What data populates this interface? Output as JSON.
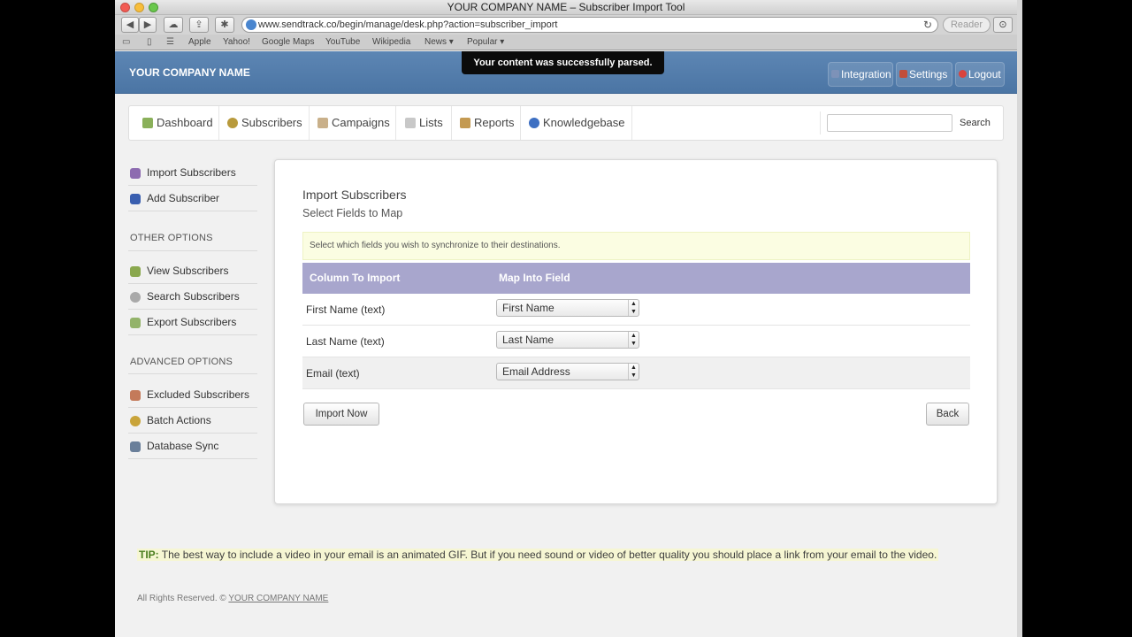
{
  "browser": {
    "window_title": "YOUR COMPANY NAME – Subscriber Import Tool",
    "url": "www.sendtrack.co/begin/manage/desk.php?action=subscriber_import",
    "reader_label": "Reader",
    "bookmarks": [
      "Apple",
      "Yahoo!",
      "Google Maps",
      "YouTube",
      "Wikipedia",
      "News ▾",
      "Popular ▾"
    ]
  },
  "header": {
    "company_name": "YOUR COMPANY NAME",
    "toast": "Your content was successfully parsed.",
    "buttons": [
      {
        "label": "Integration",
        "icon": "plug-icon"
      },
      {
        "label": "Settings",
        "icon": "tools-icon"
      },
      {
        "label": "Logout",
        "icon": "power-icon"
      }
    ]
  },
  "nav": {
    "items": [
      {
        "label": "Dashboard",
        "icon": "dashboard-icon"
      },
      {
        "label": "Subscribers",
        "icon": "subscribers-icon"
      },
      {
        "label": "Campaigns",
        "icon": "campaigns-icon"
      },
      {
        "label": "Lists",
        "icon": "lists-icon"
      },
      {
        "label": "Reports",
        "icon": "reports-icon"
      },
      {
        "label": "Knowledgebase",
        "icon": "help-icon"
      }
    ],
    "search_value": "",
    "search_button": "Search"
  },
  "sidebar": {
    "top_items": [
      {
        "label": "Import Subscribers",
        "icon": "import-users-icon"
      },
      {
        "label": "Add Subscriber",
        "icon": "add-user-icon"
      }
    ],
    "other_heading": "OTHER OPTIONS",
    "other_items": [
      {
        "label": "View Subscribers",
        "icon": "view-users-icon"
      },
      {
        "label": "Search Subscribers",
        "icon": "search-users-icon"
      },
      {
        "label": "Export Subscribers",
        "icon": "export-users-icon"
      }
    ],
    "advanced_heading": "ADVANCED OPTIONS",
    "advanced_items": [
      {
        "label": "Excluded Subscribers",
        "icon": "excluded-user-icon"
      },
      {
        "label": "Batch Actions",
        "icon": "batch-icon"
      },
      {
        "label": "Database Sync",
        "icon": "database-icon"
      }
    ]
  },
  "main": {
    "title": "Import Subscribers",
    "subtitle": "Select Fields to Map",
    "info": "Select which fields you wish to synchronize to their destinations.",
    "table": {
      "headers": [
        "Column To Import",
        "Map Into Field"
      ],
      "rows": [
        {
          "column": "First Name (text)",
          "field": "First Name"
        },
        {
          "column": "Last Name (text)",
          "field": "Last Name"
        },
        {
          "column": "Email (text)",
          "field": "Email Address"
        }
      ]
    },
    "import_button": "Import Now",
    "back_button": "Back"
  },
  "footer": {
    "tip_label": "TIP:",
    "tip_text": "The best way to include a video in your email is an animated GIF. But if you need sound or video of better quality you should place a link from your email to the video.",
    "copyright_prefix": "All Rights Reserved. ©",
    "copyright_company": "YOUR COMPANY NAME"
  },
  "colors": {
    "header_blue": "#4e78a7",
    "table_header": "#a8a6cd",
    "info_bg": "#fbfde2",
    "tip_green": "#4a7d1e"
  }
}
